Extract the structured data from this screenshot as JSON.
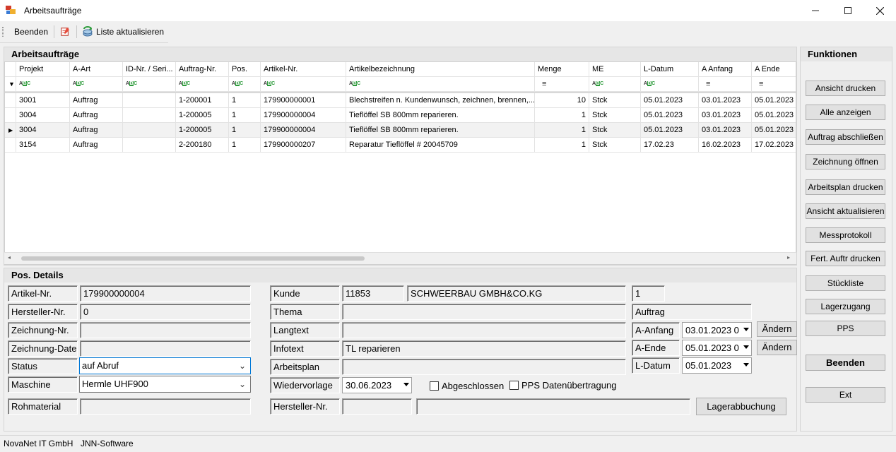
{
  "window": {
    "title": "Arbeitsaufträge",
    "controls": [
      "minimize-icon",
      "maximize-icon",
      "close-icon"
    ]
  },
  "toolbar": {
    "beenden": "Beenden",
    "liste_aktualisieren": "Liste aktualisieren"
  },
  "grid": {
    "title": "Arbeitsaufträge",
    "columns": [
      "Projekt",
      "A-Art",
      "ID-Nr. / Seri...",
      "Auftrag-Nr.",
      "Pos.",
      "Artikel-Nr.",
      "Artikelbezeichnung",
      "Menge",
      "ME",
      "L-Datum",
      "A Anfang",
      "A Ende"
    ],
    "filter_types": [
      "abc",
      "abc",
      "abc",
      "abc",
      "abc",
      "abc",
      "abc",
      "eq",
      "abc",
      "abc",
      "eq",
      "eq"
    ],
    "rows": [
      [
        "3001",
        "Auftrag",
        "",
        "1-200001",
        "1",
        "179900000001",
        "Blechstreifen n. Kundenwunsch, zeichnen, brennen,...",
        "10",
        "Stck",
        "05.01.2023",
        "03.01.2023",
        "05.01.2023"
      ],
      [
        "3004",
        "Auftrag",
        "",
        "1-200005",
        "1",
        "179900000004",
        "Tieflöffel SB 800mm reparieren.",
        "1",
        "Stck",
        "05.01.2023",
        "03.01.2023",
        "05.01.2023"
      ],
      [
        "3004",
        "Auftrag",
        "",
        "1-200005",
        "1",
        "179900000004",
        "Tieflöffel SB 800mm reparieren.",
        "1",
        "Stck",
        "05.01.2023",
        "03.01.2023",
        "05.01.2023"
      ],
      [
        "3154",
        "Auftrag",
        "",
        "2-200180",
        "1",
        "179900000207",
        "Reparatur Tieflöffel # 20045709",
        "1",
        "Stck",
        "17.02.23",
        "16.02.2023",
        "17.02.2023"
      ]
    ],
    "current_row_index": 2
  },
  "details": {
    "title": "Pos. Details",
    "artikel_nr_label": "Artikel-Nr.",
    "artikel_nr": "179900000004",
    "hersteller_nr_label": "Hersteller-Nr.",
    "hersteller_nr": "0",
    "zeichnung_nr_label": "Zeichnung-Nr.",
    "zeichnung_nr": "",
    "zeichnung_date_label": "Zeichnung-Date",
    "zeichnung_date": "",
    "status_label": "Status",
    "status": "auf Abruf",
    "maschine_label": "Maschine",
    "maschine": "Hermle UHF900",
    "rohmaterial_label": "Rohmaterial",
    "rohmaterial": "",
    "kunde_label": "Kunde",
    "kunde_nr": "11853",
    "kunde_name": "SCHWEERBAU GMBH&CO.KG",
    "kunde_extra": "1",
    "thema_label": "Thema",
    "thema": "",
    "thema_right": "Auftrag",
    "langtext_label": "Langtext",
    "langtext": "",
    "infotext_label": "Infotext",
    "infotext": "TL reparieren",
    "arbeitsplan_label": "Arbeitsplan",
    "arbeitsplan": "",
    "wiedervorlage_label": "Wiedervorlage",
    "wiedervorlage": "30.06.2023",
    "abgeschlossen_label": "Abgeschlossen",
    "abgeschlossen": false,
    "pps_label": "PPS Datenübertragung",
    "pps": false,
    "hersteller_nr2_label": "Hersteller-Nr.",
    "hersteller_nr2": "",
    "hersteller_nr2_extra": "",
    "lagerabbuchung": "Lagerabbuchung",
    "a_anfang_label": "A-Anfang",
    "a_anfang": "03.01.2023 0",
    "a_ende_label": "A-Ende",
    "a_ende": "05.01.2023 0",
    "l_datum_label": "L-Datum",
    "l_datum": "05.01.2023",
    "aendern1": "Ändern",
    "aendern2": "Ändern"
  },
  "funktionen": {
    "title": "Funktionen",
    "buttons": [
      "Ansicht drucken",
      "Alle anzeigen",
      "Auftrag abschließen",
      "Zeichnung öffnen",
      "Arbeitsplan drucken",
      "Ansicht aktualisieren",
      "Messprotokoll",
      "Fert. Auftr drucken",
      "Stückliste",
      "Lagerzugang",
      "PPS",
      "Beenden",
      "Ext"
    ]
  },
  "status_bar": {
    "company": "NovaNet IT GmbH",
    "software": "JNN-Software"
  }
}
